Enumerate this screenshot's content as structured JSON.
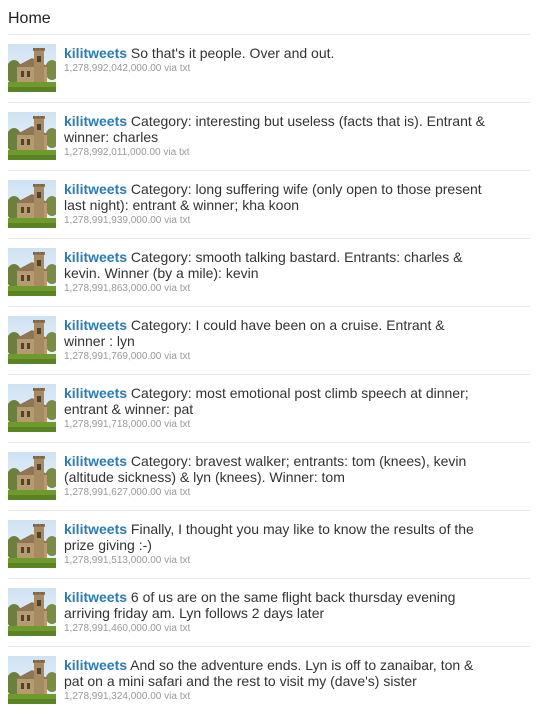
{
  "page": {
    "title": "Home"
  },
  "tweets": [
    {
      "username": "kilitweets",
      "text": "So that's it people. Over and out.",
      "timestamp": "1,278,992,042,000.00",
      "via_label": "via",
      "source": "txt"
    },
    {
      "username": "kilitweets",
      "text": "Category: interesting but useless (facts that is). Entrant & winner: charles",
      "timestamp": "1,278,992,011,000.00",
      "via_label": "via",
      "source": "txt"
    },
    {
      "username": "kilitweets",
      "text": "Category: long suffering wife (only open to those present last night): entrant & winner; kha koon",
      "timestamp": "1,278,991,939,000.00",
      "via_label": "via",
      "source": "txt"
    },
    {
      "username": "kilitweets",
      "text": "Category: smooth talking bastard. Entrants: charles & kevin. Winner (by a mile): kevin",
      "timestamp": "1,278,991,863,000.00",
      "via_label": "via",
      "source": "txt"
    },
    {
      "username": "kilitweets",
      "text": "Category: I could have been on a cruise. Entrant & winner : lyn",
      "timestamp": "1,278,991,769,000.00",
      "via_label": "via",
      "source": "txt"
    },
    {
      "username": "kilitweets",
      "text": "Category: most emotional post climb speech at dinner; entrant & winner: pat",
      "timestamp": "1,278,991,718,000.00",
      "via_label": "via",
      "source": "txt"
    },
    {
      "username": "kilitweets",
      "text": "Category: bravest walker; entrants: tom (knees), kevin (altitude sickness) & lyn (knees). Winner: tom",
      "timestamp": "1,278,991,627,000.00",
      "via_label": "via",
      "source": "txt"
    },
    {
      "username": "kilitweets",
      "text": "Finally, I thought you may like to know the results of the prize giving :-)",
      "timestamp": "1,278,991,513,000.00",
      "via_label": "via",
      "source": "txt"
    },
    {
      "username": "kilitweets",
      "text": "6 of us are on the same flight back thursday evening arriving friday am. Lyn follows 2 days later",
      "timestamp": "1,278,991,460,000.00",
      "via_label": "via",
      "source": "txt"
    },
    {
      "username": "kilitweets",
      "text": "And so the adventure ends. Lyn is off to zanaibar, ton & pat on a mini safari and the rest to visit my (dave's) sister",
      "timestamp": "1,278,991,324,000.00",
      "via_label": "via",
      "source": "txt"
    }
  ],
  "colors": {
    "username": "#2b7bb9",
    "text": "#333333",
    "meta": "#999999",
    "divider": "#e8e8e8"
  },
  "icons": {
    "avatar": "church-tower-avatar-icon"
  }
}
